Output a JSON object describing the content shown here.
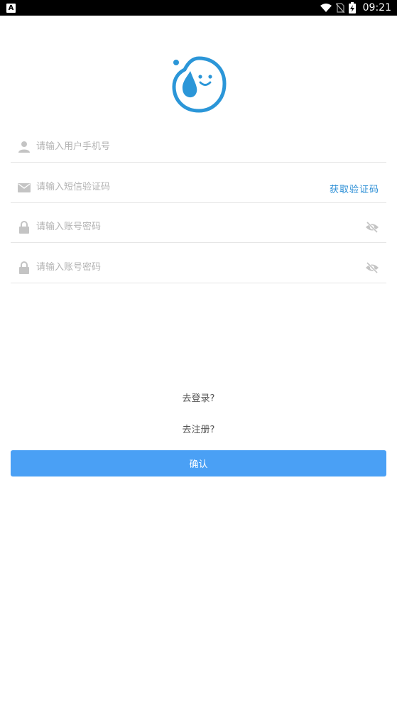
{
  "status_bar": {
    "left_icon_letter": "A",
    "time": "09:21",
    "icons": [
      "wifi-icon",
      "no-sim-icon",
      "battery-charging-icon"
    ]
  },
  "logo": {
    "icon": "water-drop-logo-icon",
    "color": "#2b96d8"
  },
  "form": {
    "phone": {
      "placeholder": "请输入用户手机号",
      "icon": "user-icon"
    },
    "sms_code": {
      "placeholder": "请输入短信验证码",
      "icon": "envelope-icon",
      "action_label": "获取验证码"
    },
    "password": {
      "placeholder": "请输入账号密码",
      "icon": "lock-icon",
      "toggle_icon": "eye-off-icon"
    },
    "confirm_password": {
      "placeholder": "请输入账号密码",
      "icon": "lock-icon",
      "toggle_icon": "eye-off-icon"
    }
  },
  "links": {
    "login": "去登录?",
    "register": "去注册?"
  },
  "confirm_button": {
    "label": "确认",
    "color": "#4aa0f5"
  },
  "colors": {
    "accent": "#2d8fd6",
    "placeholder": "#b3b3b3",
    "divider": "#e6e6e6"
  }
}
